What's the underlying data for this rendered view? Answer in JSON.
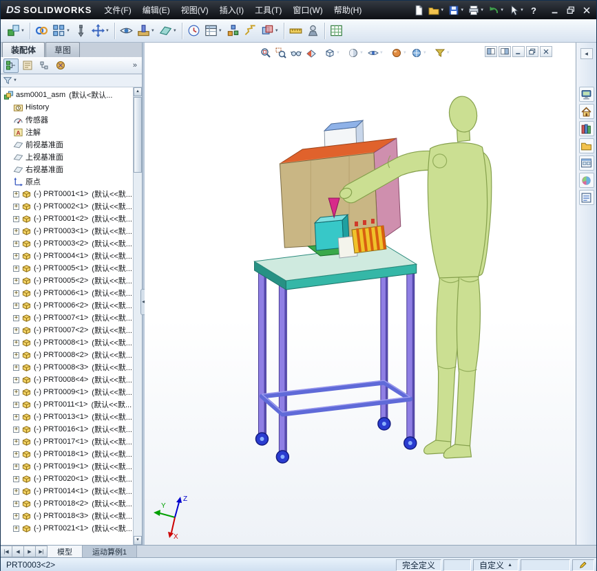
{
  "titlebar": {
    "logo_ds": "DS",
    "logo_text": "SOLIDWORKS",
    "menus": [
      "文件(F)",
      "编辑(E)",
      "视图(V)",
      "插入(I)",
      "工具(T)",
      "窗口(W)",
      "帮助(H)"
    ],
    "quick_icons": [
      {
        "name": "new-document",
        "dropdown": false
      },
      {
        "name": "open",
        "dropdown": true
      },
      {
        "name": "save",
        "dropdown": true
      },
      {
        "name": "print",
        "dropdown": true
      },
      {
        "name": "undo",
        "dropdown": true
      },
      {
        "name": "select",
        "dropdown": true
      },
      {
        "name": "help",
        "dropdown": false
      }
    ],
    "window_buttons": [
      "minimize",
      "restore",
      "close"
    ]
  },
  "toolbar": {
    "items": [
      {
        "name": "insert-components",
        "dropdown": true
      },
      {
        "sep": true
      },
      {
        "name": "mate",
        "dropdown": false
      },
      {
        "name": "linear-component-pattern",
        "dropdown": true
      },
      {
        "name": "smart-fasteners",
        "dropdown": false
      },
      {
        "name": "move-component",
        "dropdown": true
      },
      {
        "sep": true
      },
      {
        "name": "show-hidden-components",
        "dropdown": false
      },
      {
        "name": "assembly-features",
        "dropdown": true
      },
      {
        "name": "reference-geometry",
        "dropdown": true
      },
      {
        "sep": true
      },
      {
        "name": "new-motion-study",
        "dropdown": false
      },
      {
        "name": "bill-of-materials",
        "dropdown": true
      },
      {
        "name": "exploded-view",
        "dropdown": false
      },
      {
        "name": "explode-line-sketch",
        "dropdown": false
      },
      {
        "name": "interference-detection",
        "dropdown": true
      },
      {
        "sep": true
      },
      {
        "name": "measure",
        "dropdown": false
      },
      {
        "name": "mass-properties",
        "dropdown": false
      },
      {
        "sep": true
      },
      {
        "name": "spreadsheet",
        "dropdown": false
      }
    ]
  },
  "left_panel": {
    "doc_tabs": [
      {
        "label": "装配体",
        "active": true
      },
      {
        "label": "草图",
        "active": false
      }
    ],
    "fm_tabs": [
      "fm-tree",
      "fm-properties",
      "fm-configurations",
      "fm-dimxpert"
    ],
    "fm_overflow": "»",
    "tree": [
      {
        "icon": "assembly",
        "label": "asm0001_asm",
        "config": "(默认<默认...",
        "level": 0
      },
      {
        "icon": "history",
        "label": "History",
        "level": 1
      },
      {
        "icon": "sensors",
        "label": "传感器",
        "level": 1
      },
      {
        "icon": "annotations",
        "label": "注解",
        "level": 1
      },
      {
        "icon": "plane",
        "label": "前视基准面",
        "level": 1
      },
      {
        "icon": "plane",
        "label": "上视基准面",
        "level": 1
      },
      {
        "icon": "plane",
        "label": "右视基准面",
        "level": 1
      },
      {
        "icon": "origin",
        "label": "原点",
        "level": 1
      },
      {
        "icon": "part",
        "expand": true,
        "label": "(-) PRT0001<1>",
        "config": "(默认<<默...",
        "level": 1
      },
      {
        "icon": "part",
        "expand": true,
        "label": "(-) PRT0002<1>",
        "config": "(默认<<默...",
        "level": 1
      },
      {
        "icon": "part",
        "expand": true,
        "label": "(-) PRT0001<2>",
        "config": "(默认<<默...",
        "level": 1
      },
      {
        "icon": "part",
        "expand": true,
        "label": "(-) PRT0003<1>",
        "config": "(默认<<默...",
        "level": 1
      },
      {
        "icon": "part",
        "expand": true,
        "label": "(-) PRT0003<2>",
        "config": "(默认<<默...",
        "level": 1
      },
      {
        "icon": "part",
        "expand": true,
        "label": "(-) PRT0004<1>",
        "config": "(默认<<默...",
        "level": 1
      },
      {
        "icon": "part",
        "expand": true,
        "label": "(-) PRT0005<1>",
        "config": "(默认<<默...",
        "level": 1
      },
      {
        "icon": "part",
        "expand": true,
        "label": "(-) PRT0005<2>",
        "config": "(默认<<默...",
        "level": 1
      },
      {
        "icon": "part",
        "expand": true,
        "label": "(-) PRT0006<1>",
        "config": "(默认<<默...",
        "level": 1
      },
      {
        "icon": "part",
        "expand": true,
        "label": "(-) PRT0006<2>",
        "config": "(默认<<默...",
        "level": 1
      },
      {
        "icon": "part",
        "expand": true,
        "label": "(-) PRT0007<1>",
        "config": "(默认<<默...",
        "level": 1
      },
      {
        "icon": "part",
        "expand": true,
        "label": "(-) PRT0007<2>",
        "config": "(默认<<默...",
        "level": 1
      },
      {
        "icon": "part",
        "expand": true,
        "label": "(-) PRT0008<1>",
        "config": "(默认<<默...",
        "level": 1
      },
      {
        "icon": "part",
        "expand": true,
        "label": "(-) PRT0008<2>",
        "config": "(默认<<默...",
        "level": 1
      },
      {
        "icon": "part",
        "expand": true,
        "label": "(-) PRT0008<3>",
        "config": "(默认<<默...",
        "level": 1
      },
      {
        "icon": "part",
        "expand": true,
        "label": "(-) PRT0008<4>",
        "config": "(默认<<默...",
        "level": 1
      },
      {
        "icon": "part",
        "expand": true,
        "label": "(-) PRT0009<1>",
        "config": "(默认<<默...",
        "level": 1
      },
      {
        "icon": "part",
        "expand": true,
        "label": "(-) PRT0011<1>",
        "config": "(默认<<默...",
        "level": 1
      },
      {
        "icon": "part",
        "expand": true,
        "label": "(-) PRT0013<1>",
        "config": "(默认<<默...",
        "level": 1
      },
      {
        "icon": "part",
        "expand": true,
        "label": "(-) PRT0016<1>",
        "config": "(默认<<默...",
        "level": 1
      },
      {
        "icon": "part",
        "expand": true,
        "label": "(-) PRT0017<1>",
        "config": "(默认<<默...",
        "level": 1
      },
      {
        "icon": "part",
        "expand": true,
        "label": "(-) PRT0018<1>",
        "config": "(默认<<默...",
        "level": 1
      },
      {
        "icon": "part",
        "expand": true,
        "label": "(-) PRT0019<1>",
        "config": "(默认<<默...",
        "level": 1
      },
      {
        "icon": "part",
        "expand": true,
        "label": "(-) PRT0020<1>",
        "config": "(默认<<默...",
        "level": 1
      },
      {
        "icon": "part",
        "expand": true,
        "label": "(-) PRT0014<1>",
        "config": "(默认<<默...",
        "level": 1
      },
      {
        "icon": "part",
        "expand": true,
        "label": "(-) PRT0018<2>",
        "config": "(默认<<默...",
        "level": 1
      },
      {
        "icon": "part",
        "expand": true,
        "label": "(-) PRT0018<3>",
        "config": "(默认<<默...",
        "level": 1
      },
      {
        "icon": "part",
        "expand": true,
        "label": "(-) PRT0021<1>",
        "config": "(默认<<默...",
        "level": 1
      }
    ]
  },
  "viewport": {
    "hud": [
      {
        "name": "zoom-fit",
        "dropdown": false
      },
      {
        "name": "zoom-area",
        "dropdown": false
      },
      {
        "name": "zoom-selection",
        "dropdown": false
      },
      {
        "name": "section-view",
        "dropdown": false
      },
      {
        "sep": true
      },
      {
        "name": "view-orientation",
        "dropdown": true
      },
      {
        "sep": true
      },
      {
        "name": "display-style",
        "dropdown": true
      },
      {
        "name": "hide-show-items",
        "dropdown": true
      },
      {
        "sep": true
      },
      {
        "name": "edit-appearance",
        "dropdown": true
      },
      {
        "name": "apply-scene",
        "dropdown": true
      },
      {
        "sep": true
      },
      {
        "name": "view-settings",
        "dropdown": true
      }
    ],
    "mdi_buttons": [
      "pane-left",
      "pane-right",
      "doc-minimize",
      "doc-restore",
      "doc-close"
    ],
    "triad": {
      "x_label": "X",
      "y_label": "Y",
      "z_label": "Z"
    }
  },
  "task_pane": {
    "collapse": "◀",
    "items": [
      "resources",
      "home",
      "design-library",
      "file-explorer",
      "view-palette",
      "appearances-scenes",
      "custom-properties"
    ]
  },
  "tab_bar": {
    "nav": [
      "|◀",
      "◀",
      "▶",
      "▶|"
    ],
    "tabs": [
      {
        "label": "模型",
        "active": true
      },
      {
        "label": "运动算例1",
        "active": false
      }
    ]
  },
  "status_bar": {
    "left": "PRT0003<2>",
    "definition": "完全定义",
    "custom": "自定义"
  },
  "colors": {
    "mannequin": "#cbdf92",
    "mannequin-dark": "#85a04c",
    "machine-front": "#c9b684",
    "machine-top": "#e0622c",
    "machine-side": "#cf8fae",
    "table-top": "#cfeadf",
    "table-edge": "#35b7a7",
    "table-edge-dark": "#279184",
    "leg": "#8f7fe4",
    "leg-dark": "#564aac",
    "shelf": "#5f6ad8",
    "wheel": "#2a3cd0",
    "wheel-hub": "#8ab0ff"
  }
}
